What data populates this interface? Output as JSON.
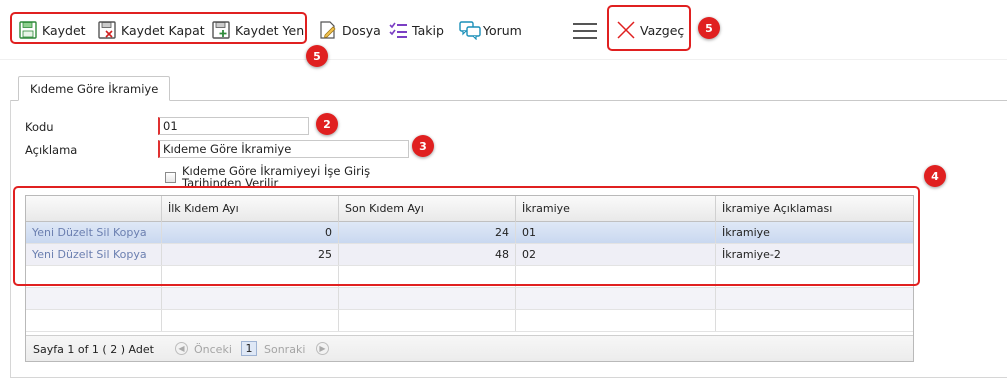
{
  "toolbar": {
    "save": "Kaydet",
    "save_close": "Kaydet Kapat",
    "save_new": "Kaydet Yeni",
    "file": "Dosya",
    "track": "Takip",
    "comment": "Yorum",
    "cancel": "Vazgeç"
  },
  "badges": {
    "b1": "5",
    "b2": "2",
    "b3": "3",
    "b4": "4",
    "b5": "5"
  },
  "tab": {
    "label": "Kıdeme Göre İkramiye"
  },
  "form": {
    "code_label": "Kodu",
    "code_value": "01",
    "desc_label": "Açıklama",
    "desc_value": "Kıdeme Göre İkramiye",
    "checkbox_label": "Kıdeme Göre İkramiyeyi İşe Giriş Tarihinden Verilir"
  },
  "grid": {
    "columns": [
      "",
      "İlk Kıdem Ayı",
      "Son Kıdem Ayı",
      "İkramiye",
      "İkramiye Açıklaması"
    ],
    "rows": [
      {
        "actions": "Yeni Düzelt Sil Kopya",
        "ilk": "0",
        "son": "24",
        "ikramiye": "01",
        "aciklama": "İkramiye"
      },
      {
        "actions": "Yeni Düzelt Sil Kopya",
        "ilk": "25",
        "son": "48",
        "ikramiye": "02",
        "aciklama": "İkramiye-2"
      }
    ]
  },
  "pager": {
    "summary": "Sayfa 1 of 1 ( 2 ) Adet",
    "prev": "Önceki",
    "page": "1",
    "next": "Sonraki"
  },
  "colors": {
    "highlight": "#e02020",
    "selected_row": "#d3e0f4",
    "link": "#6b7fb0"
  }
}
